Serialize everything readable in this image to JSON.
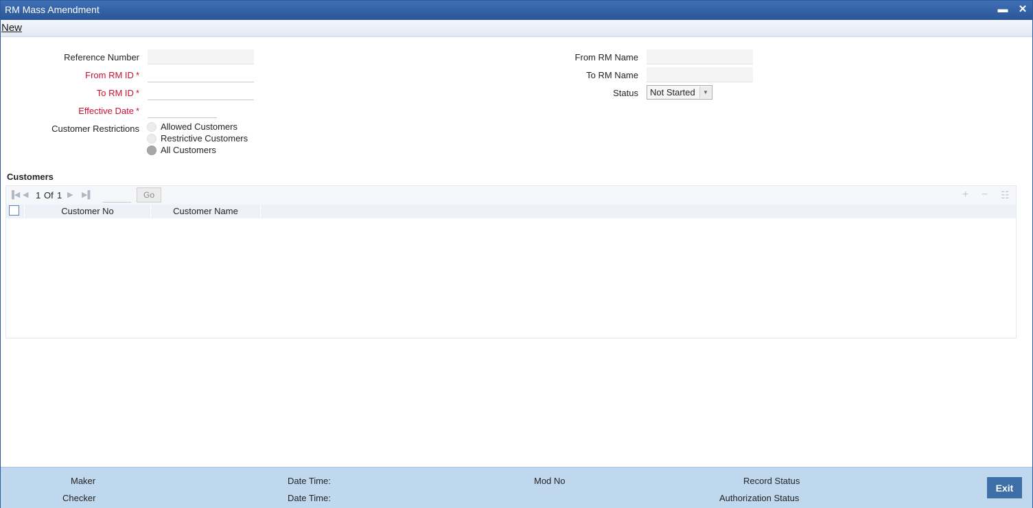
{
  "window": {
    "title": "RM Mass Amendment",
    "minimize_glyph": "▬",
    "close_glyph": "✕"
  },
  "menu": {
    "new_label": "New"
  },
  "form": {
    "reference_number": {
      "label": "Reference Number",
      "value": ""
    },
    "from_rm_id": {
      "label": "From RM ID",
      "value": "",
      "required": true
    },
    "to_rm_id": {
      "label": "To RM ID",
      "value": "",
      "required": true
    },
    "effective_date": {
      "label": "Effective Date",
      "value": "",
      "required": true
    },
    "required_marker": "*",
    "customer_restrictions": {
      "label": "Customer Restrictions",
      "options": [
        "Allowed Customers",
        "Restrictive Customers",
        "All Customers"
      ],
      "selected": "All Customers"
    },
    "from_rm_name": {
      "label": "From RM Name",
      "value": ""
    },
    "to_rm_name": {
      "label": "To RM Name",
      "value": ""
    },
    "status": {
      "label": "Status",
      "value": "Not Started"
    }
  },
  "customers": {
    "section_title": "Customers",
    "pagination": {
      "current": "1",
      "of_label": "Of",
      "total": "1",
      "go_label": "Go"
    },
    "columns": [
      "Customer No",
      "Customer Name"
    ],
    "rows": []
  },
  "footer": {
    "maker_label": "Maker",
    "checker_label": "Checker",
    "date_time_label_1": "Date Time:",
    "date_time_label_2": "Date Time:",
    "mod_no_label": "Mod No",
    "record_status_label": "Record Status",
    "authorization_status_label": "Authorization Status",
    "exit_label": "Exit"
  },
  "colors": {
    "titlebar": "#2a5697",
    "required": "#c8102e",
    "footer": "#c0d8ee",
    "exit_button": "#3e6ea8"
  }
}
